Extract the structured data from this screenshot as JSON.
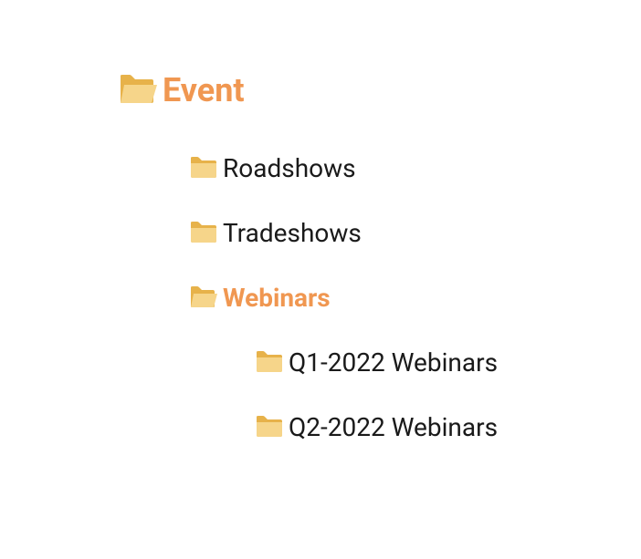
{
  "tree": {
    "root": {
      "label": "Event"
    },
    "children": [
      {
        "label": "Roadshows"
      },
      {
        "label": "Tradeshows"
      },
      {
        "label": "Webinars"
      }
    ],
    "grandchildren": [
      {
        "label": "Q1-2022 Webinars"
      },
      {
        "label": "Q2-2022 Webinars"
      }
    ]
  },
  "colors": {
    "accent": "#f09751",
    "folderLight": "#f6d58a",
    "folderDark": "#e7b24a"
  }
}
